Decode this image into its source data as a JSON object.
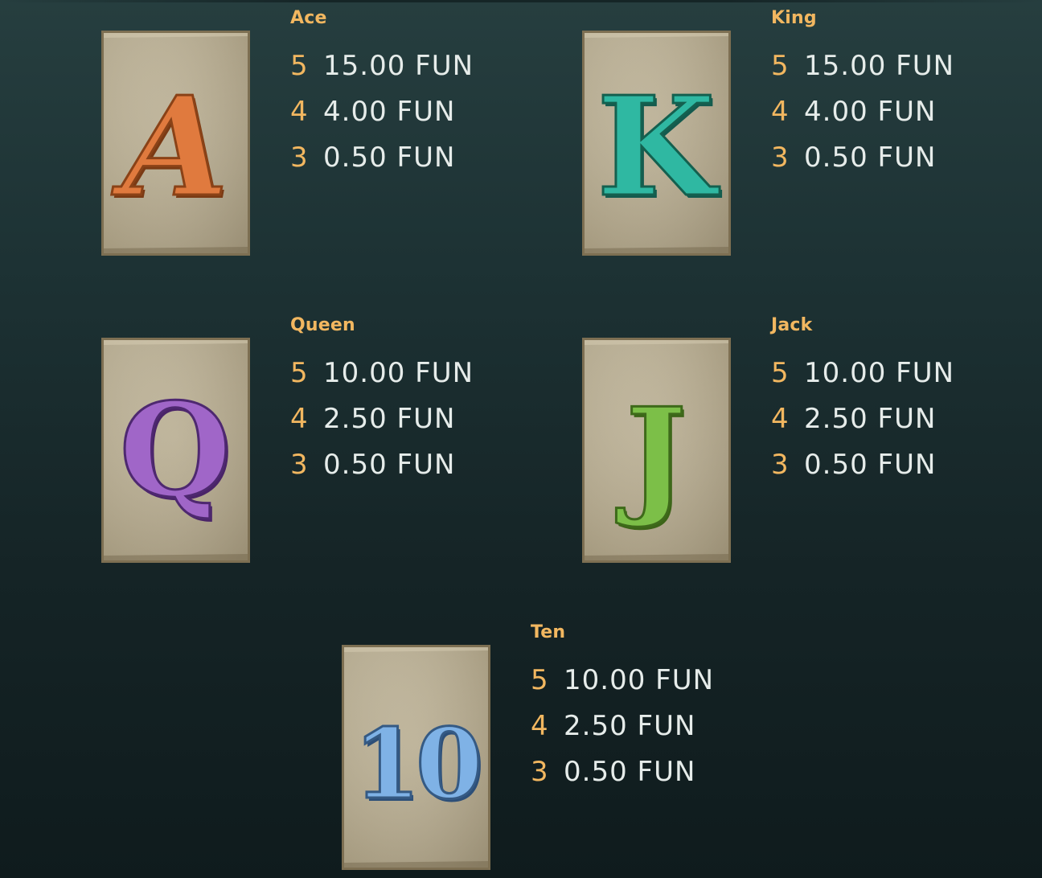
{
  "paytable": {
    "symbols": [
      {
        "name": "Ace",
        "glyph": "A",
        "color": "#e07a3e",
        "payouts": [
          {
            "count": "5",
            "value": "15.00 FUN"
          },
          {
            "count": "4",
            "value": "4.00 FUN"
          },
          {
            "count": "3",
            "value": "0.50 FUN"
          }
        ]
      },
      {
        "name": "King",
        "glyph": "K",
        "color": "#2fb8a2",
        "payouts": [
          {
            "count": "5",
            "value": "15.00 FUN"
          },
          {
            "count": "4",
            "value": "4.00 FUN"
          },
          {
            "count": "3",
            "value": "0.50 FUN"
          }
        ]
      },
      {
        "name": "Queen",
        "glyph": "Q",
        "color": "#a066c8",
        "payouts": [
          {
            "count": "5",
            "value": "10.00 FUN"
          },
          {
            "count": "4",
            "value": "2.50 FUN"
          },
          {
            "count": "3",
            "value": "0.50 FUN"
          }
        ]
      },
      {
        "name": "Jack",
        "glyph": "J",
        "color": "#7cbf48",
        "payouts": [
          {
            "count": "5",
            "value": "10.00 FUN"
          },
          {
            "count": "4",
            "value": "2.50 FUN"
          },
          {
            "count": "3",
            "value": "0.50 FUN"
          }
        ]
      },
      {
        "name": "Ten",
        "glyph": "10",
        "color": "#7fb2e6",
        "payouts": [
          {
            "count": "5",
            "value": "10.00 FUN"
          },
          {
            "count": "4",
            "value": "2.50 FUN"
          },
          {
            "count": "3",
            "value": "0.50 FUN"
          }
        ]
      }
    ]
  },
  "colors": {
    "label": "#f2b760",
    "value": "#e6ecea",
    "stone": "#b9ae92"
  }
}
